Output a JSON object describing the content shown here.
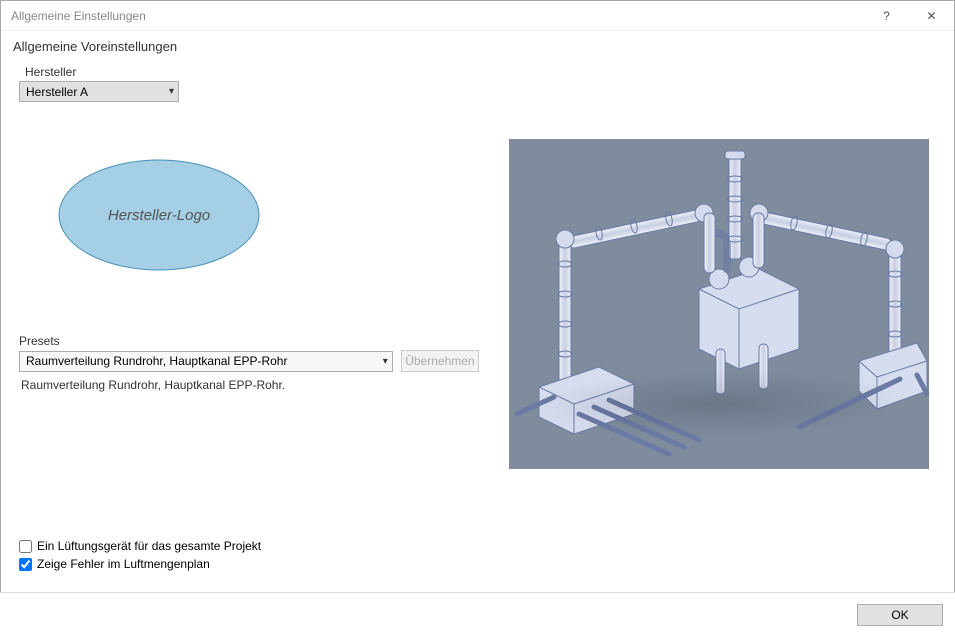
{
  "window": {
    "title": "Allgemeine Einstellungen"
  },
  "group": {
    "title": "Allgemeine Voreinstellungen"
  },
  "manufacturer": {
    "label": "Hersteller",
    "selected": "Hersteller A"
  },
  "logo": {
    "text": "Hersteller-Logo"
  },
  "presets": {
    "label": "Presets",
    "selected": "Raumverteilung Rundrohr, Hauptkanal EPP-Rohr",
    "apply_label": "Übernehmen",
    "description": "Raumverteilung Rundrohr, Hauptkanal EPP-Rohr."
  },
  "checkboxes": {
    "single_unit": {
      "label": "Ein Lüftungsgerät für das gesamte Projekt",
      "checked": false
    },
    "show_errors": {
      "label": "Zeige Fehler im Luftmengenplan",
      "checked": true
    }
  },
  "footer": {
    "ok_label": "OK"
  },
  "colors": {
    "logo_fill": "#a4cfe4",
    "logo_stroke": "#4a90b8",
    "preview_bg": "#7e8c9e",
    "pipe_fill": "#d4dbec",
    "pipe_stroke": "#6b7aa5",
    "unit_fill": "#c7cfe3"
  }
}
